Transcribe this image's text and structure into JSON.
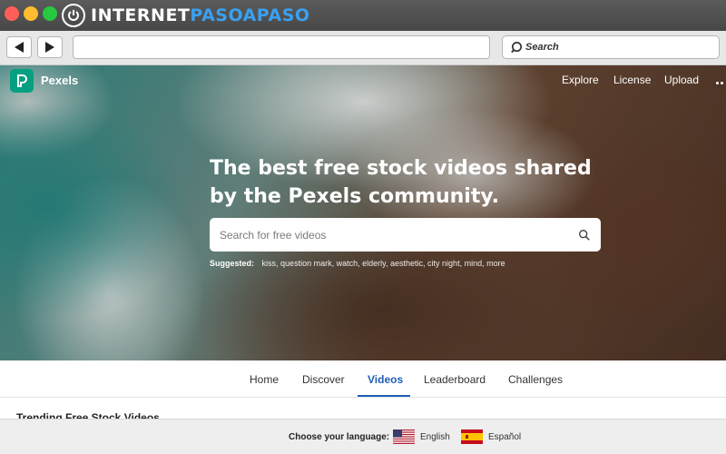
{
  "window": {
    "brand": {
      "part_a": "INTERNET",
      "part_b": "PASOAPASO"
    }
  },
  "browser": {
    "address_value": "",
    "search_placeholder": "Search"
  },
  "site": {
    "name": "Pexels",
    "nav": {
      "explore": "Explore",
      "license": "License",
      "upload": "Upload"
    }
  },
  "hero": {
    "title": "The best free stock videos shared by the Pexels community.",
    "search_placeholder": "Search for free videos",
    "suggested_label": "Suggested:",
    "suggestions": [
      "kiss,",
      "question mark,",
      "watch,",
      "elderly,",
      "aesthetic,",
      "city night,",
      "mind,",
      "more"
    ]
  },
  "tabs": {
    "home": "Home",
    "discover": "Discover",
    "videos": "Videos",
    "leaderboard": "Leaderboard",
    "challenges": "Challenges",
    "active": "Videos"
  },
  "section": {
    "title": "Trending Free Stock Videos"
  },
  "language": {
    "label": "Choose your language:",
    "options": [
      {
        "name": "English",
        "flag": "us-flag-icon"
      },
      {
        "name": "Español",
        "flag": "es-flag-icon"
      }
    ]
  },
  "colors": {
    "pexels_brand": "#05a081",
    "active_tab": "#1f5fb8",
    "brand_accent": "#3aa0f0"
  }
}
